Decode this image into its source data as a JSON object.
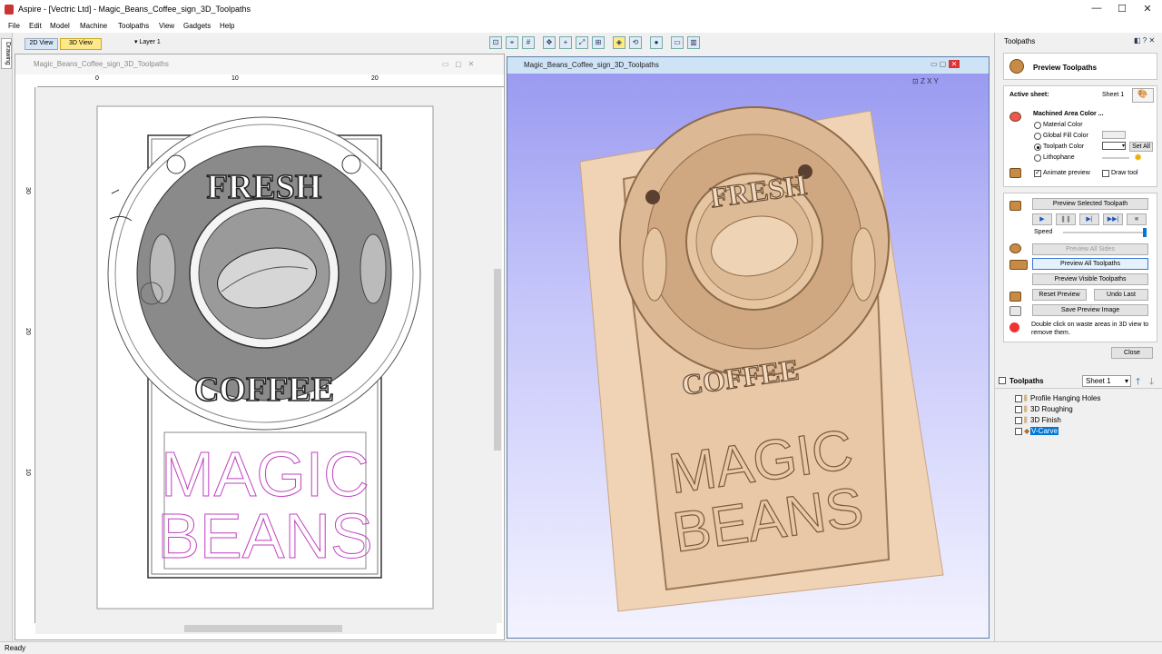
{
  "window": {
    "title": "Aspire - [Vectric Ltd] - Magic_Beans_Coffee_sign_3D_Toolpaths",
    "min": "—",
    "max": "☐",
    "close": "✕"
  },
  "menu": [
    "File",
    "Edit",
    "Model",
    "Machine",
    "Toolpaths",
    "View",
    "Gadgets",
    "Help"
  ],
  "view_tabs": {
    "tab2d": "2D View",
    "tab3d": "3D View",
    "layer": "Layer 1"
  },
  "left_strip": {
    "label": "Drawing"
  },
  "view2d": {
    "title": "Magic_Beans_Coffee_sign_3D_Toolpaths",
    "hruler": [
      "0",
      "10",
      "20"
    ],
    "vruler": [
      "30",
      "20",
      "10"
    ],
    "text_top": "FRESH",
    "text_mid": "COFFEE",
    "text_line1": "MAGIC",
    "text_line2": "BEANS"
  },
  "view3d": {
    "title": "Magic_Beans_Coffee_sign_3D_Toolpaths",
    "axes": [
      "Z",
      "X",
      "Y"
    ],
    "text_top": "FRESH",
    "text_mid": "COFFEE",
    "text_line1": "MAGIC",
    "text_line2": "BEANS"
  },
  "panel": {
    "header": "Toolpaths",
    "title": "Preview Toolpaths",
    "active_sheet_label": "Active sheet:",
    "active_sheet_value": "Sheet 1",
    "machined_color_label": "Machined Area Color ...",
    "opt_material": "Material Color",
    "opt_global": "Global Fill Color",
    "opt_toolpath": "Toolpath Color",
    "opt_litho": "Lithophane",
    "set_all": "Set All",
    "animate": "Animate preview",
    "draw_tool": "Draw tool",
    "preview_selected": "Preview Selected Toolpath",
    "speed": "Speed",
    "speed_level": 1.0,
    "preview_all_sides": "Preview All Sides",
    "preview_all": "Preview All Toolpaths",
    "preview_visible": "Preview Visible Toolpaths",
    "reset_preview": "Reset Preview",
    "undo_last": "Undo Last",
    "save_image": "Save Preview Image",
    "hint": "Double click on waste areas in 3D view to remove them.",
    "close": "Close"
  },
  "toolpaths": {
    "header": "Toolpaths",
    "sheet": "Sheet 1",
    "items": [
      "Profile Hanging Holes",
      "3D Roughing",
      "3D Finish",
      "V-Carve"
    ]
  },
  "status": {
    "text": "Ready"
  },
  "colors": {
    "accent": "#0078d7",
    "wood": "#f0d2b4",
    "magenta": "#c040c0"
  }
}
